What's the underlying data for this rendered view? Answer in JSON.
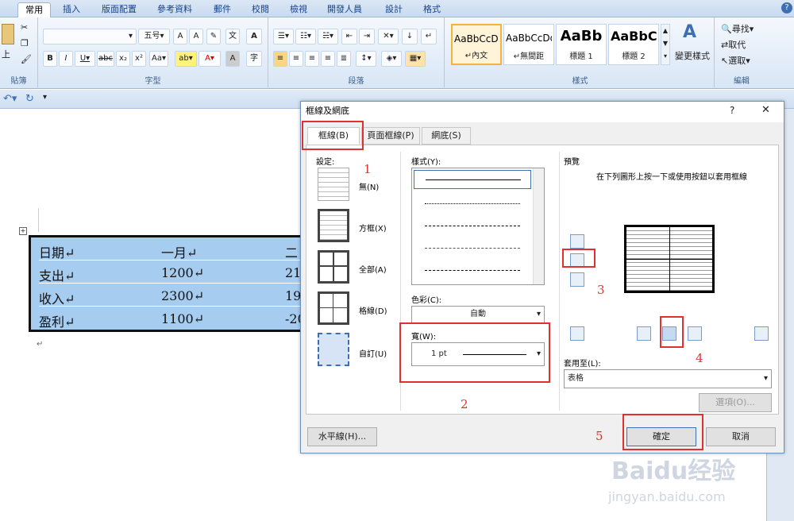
{
  "tabs": [
    "常用",
    "插入",
    "版面配置",
    "參考資料",
    "郵件",
    "校閱",
    "檢視",
    "開發人員",
    "設計",
    "格式"
  ],
  "ribbon": {
    "groups": [
      "貼簿",
      "字型",
      "段落",
      "樣式",
      "編輯"
    ],
    "paste_label": "上",
    "font_size": "五号",
    "styles": [
      {
        "sample": "AaBbCcDd",
        "name": "↵內文"
      },
      {
        "sample": "AaBbCcDd",
        "name": "↵無間距"
      },
      {
        "sample": "AaBb",
        "name": "標題 1"
      },
      {
        "sample": "AaBbC",
        "name": "標題 2"
      }
    ],
    "change_styles": "變更樣式",
    "edit_items": [
      "尋找",
      "取代",
      "選取"
    ]
  },
  "table": {
    "rows": [
      [
        "日期↵",
        "一月↵",
        "二"
      ],
      [
        "支出↵",
        "1200↵",
        "21"
      ],
      [
        "收入↵",
        "2300↵",
        "19"
      ],
      [
        "盈利↵",
        "1100↵",
        "-20"
      ]
    ]
  },
  "dialog": {
    "title": "框線及網底",
    "help": "?",
    "close": "✕",
    "tabs": [
      "框線(B)",
      "頁面框線(P)",
      "網底(S)"
    ],
    "settings_label": "設定:",
    "settings": [
      "無(N)",
      "方框(X)",
      "全部(A)",
      "格線(D)",
      "自訂(U)"
    ],
    "style_label": "樣式(Y):",
    "color_label": "色彩(C):",
    "color_value": "自動",
    "width_label": "寬(W):",
    "width_value": "1 pt",
    "preview_label": "預覽",
    "preview_hint": "在下列圖形上按一下或使用按鈕以套用框線",
    "apply_label": "套用至(L):",
    "apply_value": "表格",
    "options_button": "選項(O)...",
    "hline_button": "水平線(H)...",
    "ok_button": "確定",
    "cancel_button": "取消"
  },
  "annotations": [
    "1",
    "2",
    "3",
    "4",
    "5"
  ],
  "watermark": {
    "brand": "Baidu经验",
    "url": "jingyan.baidu.com"
  },
  "colors": {
    "highlight": "#e03030",
    "table_fill": "#a6ccf0"
  }
}
